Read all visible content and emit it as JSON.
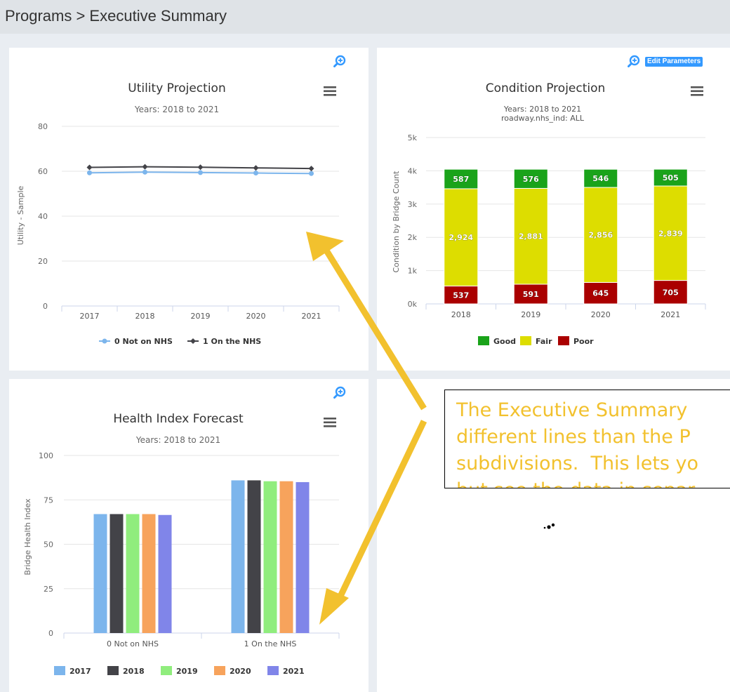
{
  "breadcrumb": "Programs > Executive Summary",
  "edit_parameters_label": "Edit Parameters",
  "colors": {
    "accent": "#3399ff",
    "arrow": "#f2c12e",
    "good": "#1aa31a",
    "fair": "#dddd00",
    "poor": "#aa0000",
    "not_nhs": "#7cb5ec",
    "on_nhs": "#434348"
  },
  "utility_projection": {
    "title": "Utility Projection",
    "subtitle": "Years: 2018 to 2021",
    "chart_data": {
      "type": "line",
      "title": "Utility Projection",
      "subtitle": "Years: 2018 to 2021",
      "ylabel": "Utility - Sample",
      "xlabel": "",
      "ylim": [
        0,
        80
      ],
      "yticks": [
        "0",
        "20",
        "40",
        "60",
        "80"
      ],
      "categories": [
        "2017",
        "2018",
        "2019",
        "2020",
        "2021"
      ],
      "series": [
        {
          "name": "0 Not on NHS",
          "color": "#7cb5ec",
          "marker": "circle",
          "values": [
            59.3,
            59.6,
            59.4,
            59.2,
            59.0
          ]
        },
        {
          "name": "1 On the NHS",
          "color": "#434348",
          "marker": "diamond",
          "values": [
            61.7,
            62.0,
            61.8,
            61.5,
            61.2
          ]
        }
      ],
      "grid": true,
      "legend": "bottom"
    }
  },
  "condition_projection": {
    "title": "Condition Projection",
    "subtitle_line1": "Years: 2018 to 2021",
    "subtitle_line2": "roadway.nhs_ind: ALL",
    "chart_data": {
      "type": "bar",
      "stacked": true,
      "title": "Condition Projection",
      "ylabel": "Condition by Bridge Count",
      "ylim": [
        0,
        5000
      ],
      "yticks": [
        "0k",
        "1k",
        "2k",
        "3k",
        "4k",
        "5k"
      ],
      "categories": [
        "2018",
        "2019",
        "2020",
        "2021"
      ],
      "series": [
        {
          "name": "Good",
          "color": "#1aa31a",
          "values": [
            587,
            576,
            546,
            505
          ],
          "labels": [
            "587",
            "576",
            "546",
            "505"
          ]
        },
        {
          "name": "Fair",
          "color": "#dddd00",
          "values": [
            2924,
            2881,
            2856,
            2839
          ],
          "labels": [
            "2,924",
            "2,881",
            "2,856",
            "2,839"
          ]
        },
        {
          "name": "Poor",
          "color": "#aa0000",
          "values": [
            537,
            591,
            645,
            705
          ],
          "labels": [
            "537",
            "591",
            "645",
            "705"
          ]
        }
      ],
      "grid": true,
      "legend": "bottom"
    }
  },
  "health_index_forecast": {
    "title": "Health Index Forecast",
    "subtitle": "Years: 2018 to 2021",
    "chart_data": {
      "type": "bar",
      "title": "Health Index Forecast",
      "ylabel": "Bridge Health Index",
      "ylim": [
        0,
        100
      ],
      "yticks": [
        "0",
        "25",
        "50",
        "75",
        "100"
      ],
      "categories": [
        "0 Not on NHS",
        "1 On the NHS"
      ],
      "series": [
        {
          "name": "2017",
          "color": "#7cb5ec",
          "values": [
            67,
            86
          ]
        },
        {
          "name": "2018",
          "color": "#434348",
          "values": [
            67,
            86
          ]
        },
        {
          "name": "2019",
          "color": "#90ed7d",
          "values": [
            67,
            85.5
          ]
        },
        {
          "name": "2020",
          "color": "#f7a35c",
          "values": [
            67,
            85.5
          ]
        },
        {
          "name": "2021",
          "color": "#8085e9",
          "values": [
            66.5,
            85
          ]
        }
      ],
      "grid": true,
      "legend": "bottom"
    }
  },
  "callout": {
    "line1": "The Executive Summary",
    "line2": "different lines than the P",
    "line3": "subdivisions.  This lets yo",
    "line4": "but see the data in separ"
  }
}
